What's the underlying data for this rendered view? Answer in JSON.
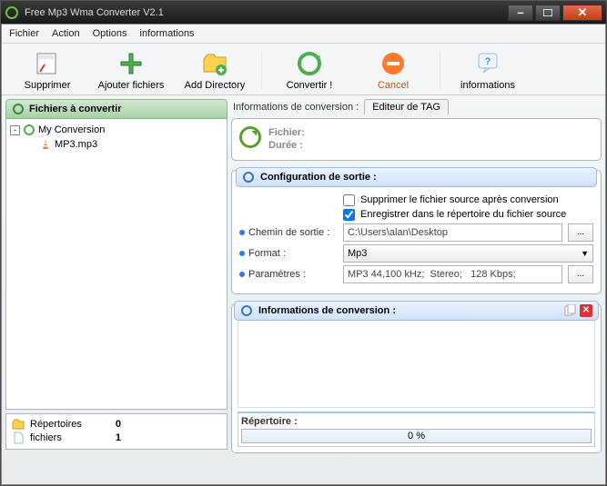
{
  "window": {
    "title": "Free Mp3 Wma Converter V2.1"
  },
  "menu": {
    "items": [
      "Fichier",
      "Action",
      "Options",
      "informations"
    ]
  },
  "toolbar": {
    "supprimer": "Supprimer",
    "ajouter": "Ajouter fichiers",
    "add_dir": "Add Directory",
    "convertir": "Convertir !",
    "cancel": "Cancel",
    "info": "informations"
  },
  "left": {
    "header": "Fichiers à convertir",
    "tree": {
      "root": "My Conversion",
      "child": "MP3.mp3"
    },
    "counts": {
      "repertoires_label": "Répertoires",
      "repertoires_value": "0",
      "fichiers_label": "fichiers",
      "fichiers_value": "1"
    }
  },
  "tabs": {
    "static": "Informations de conversion :",
    "tag": "Editeur de TAG"
  },
  "fileinfo": {
    "fichier": "Fichier:",
    "duree": "Durée :"
  },
  "config": {
    "title": "Configuration de sortie :",
    "chk_delete": "Supprimer le fichier source après conversion",
    "chk_samefolder": "Enregistrer dans le répertoire du fichier source",
    "chemin_label": "Chemin de sortie :",
    "chemin_value": "C:\\Users\\alan\\Desktop",
    "format_label": "Format :",
    "format_value": "Mp3",
    "params_label": "Paramètres :",
    "params_value": "MP3 44,100 kHz;  Stereo;   128 Kbps;",
    "browse": "..."
  },
  "infoconv": {
    "title": "Informations de conversion :",
    "repertoire": "Répertoire :",
    "progress": "0 %"
  }
}
